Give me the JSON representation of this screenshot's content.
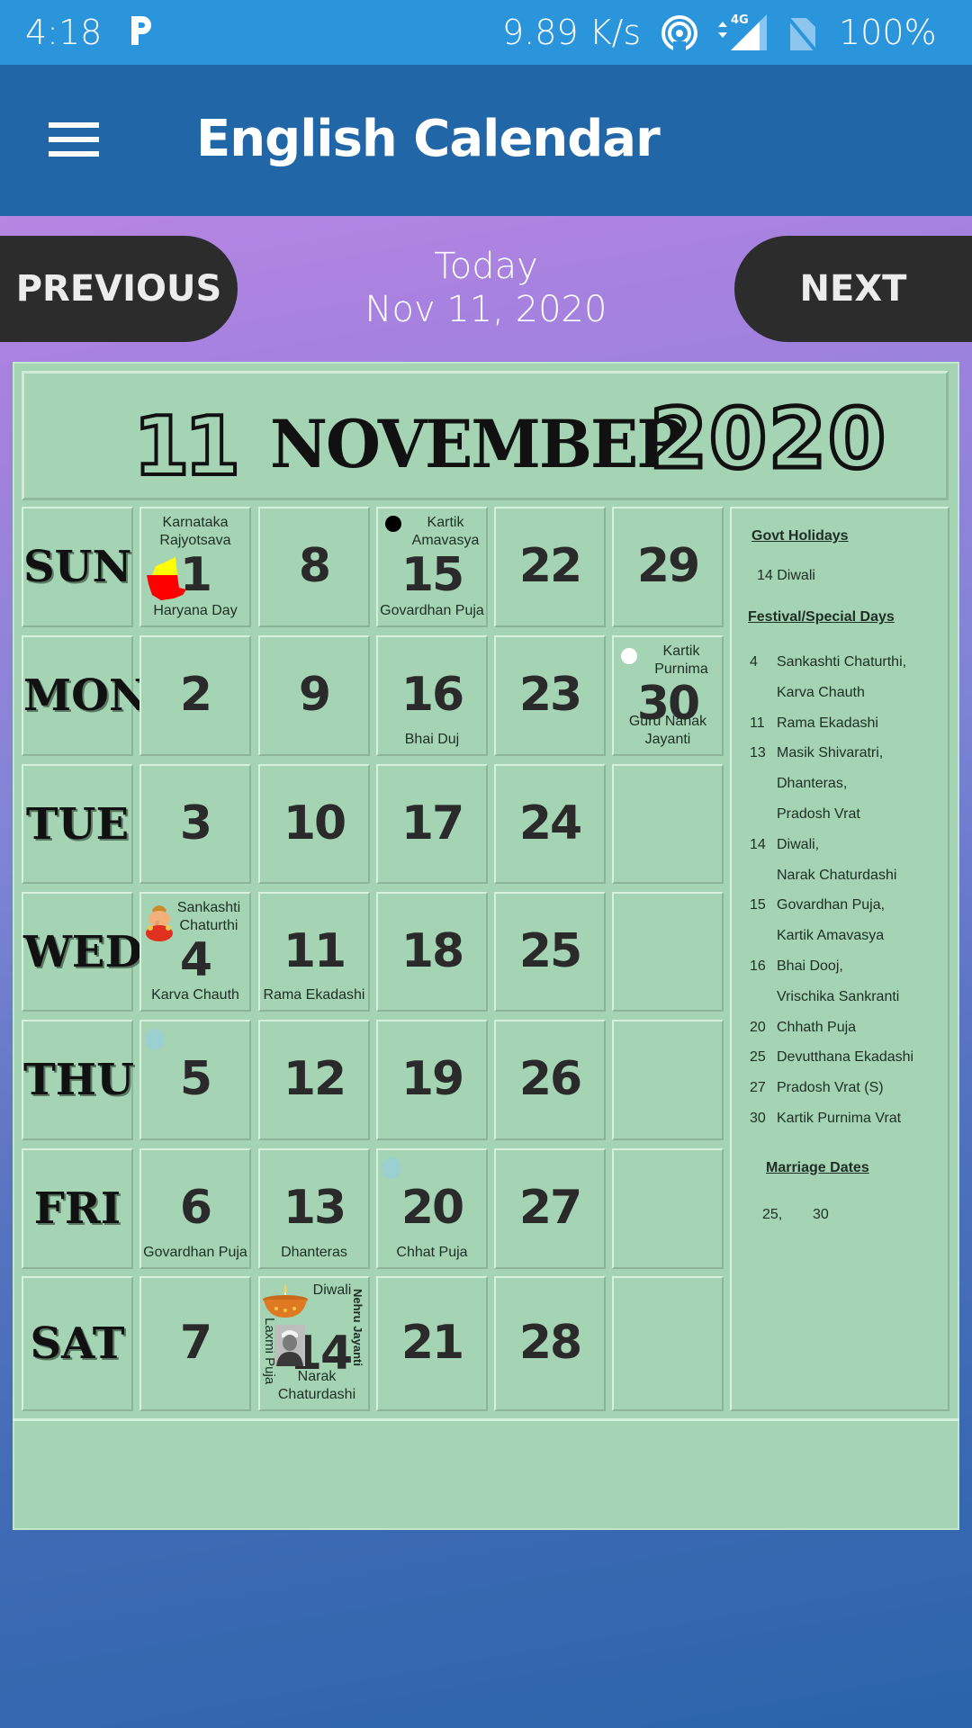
{
  "status_bar": {
    "time": "4:18",
    "network_speed": "9.89 K/s",
    "network_type": "4G",
    "battery": "100%",
    "icons": [
      "parking-app-icon",
      "hotspot-icon",
      "signal-4g-icon",
      "no-sim-icon"
    ]
  },
  "app_bar": {
    "title": "English Calendar",
    "menu_icon": "hamburger-menu-icon"
  },
  "navigation": {
    "previous_label": "PREVIOUS",
    "next_label": "NEXT",
    "today_label": "Today",
    "today_date": "Nov 11, 2020"
  },
  "calendar": {
    "title_day": "11",
    "title_month": "NOVEMBER",
    "title_year": "2020",
    "colors": {
      "panel": "#a4d4b4",
      "status_bar": "#2b95dc",
      "app_bar": "#2166a7",
      "button": "#2c2c2c"
    },
    "weekdays": [
      "SUN",
      "MON",
      "TUE",
      "WED",
      "THU",
      "FRI",
      "SAT"
    ],
    "weeks": [
      [
        {
          "day": "1",
          "top": "Karnataka Rajyotsava",
          "bottom": "Haryana Day",
          "icon": "karnataka-flag-map-icon"
        },
        {
          "day": "2"
        },
        {
          "day": "3"
        },
        {
          "day": "4",
          "top": "Sankashti Chaturthi",
          "bottom": "Karva Chauth",
          "icon": "ganesha-icon"
        },
        {
          "day": "5",
          "icon": "faint-moon-dot-icon"
        },
        {
          "day": "6",
          "bottom": "Govardhan Puja"
        },
        {
          "day": "7"
        }
      ],
      [
        {
          "day": "8"
        },
        {
          "day": "9"
        },
        {
          "day": "10"
        },
        {
          "day": "11",
          "bottom": "Rama Ekadashi"
        },
        {
          "day": "12"
        },
        {
          "day": "13",
          "bottom": "Dhanteras"
        },
        {
          "day": "14",
          "top": "Diwali",
          "bottom": "Narak Chaturdashi",
          "vertical_left": "Laxmi Puja",
          "vertical_right": "Nehru Jayanti",
          "icon": "diya-lamp-icon",
          "icon2": "nehru-portrait-icon"
        }
      ],
      [
        {
          "day": "15",
          "top": "Kartik Amavasya",
          "bottom": "Govardhan Puja",
          "icon": "new-moon-icon"
        },
        {
          "day": "16",
          "bottom": "Bhai Duj"
        },
        {
          "day": "17"
        },
        {
          "day": "18"
        },
        {
          "day": "19"
        },
        {
          "day": "20",
          "bottom": "Chhat Puja",
          "icon": "faint-moon-dot-icon"
        },
        {
          "day": "21"
        }
      ],
      [
        {
          "day": "22"
        },
        {
          "day": "23"
        },
        {
          "day": "24"
        },
        {
          "day": "25"
        },
        {
          "day": "26"
        },
        {
          "day": "27"
        },
        {
          "day": "28"
        }
      ],
      [
        {
          "day": "29"
        },
        {
          "day": "30",
          "top": "Kartik Purnima",
          "bottom": "Guru Nanak Jayanti",
          "icon": "full-moon-icon"
        },
        {
          "day": ""
        },
        {
          "day": ""
        },
        {
          "day": ""
        },
        {
          "day": ""
        },
        {
          "day": ""
        }
      ]
    ]
  },
  "side_panel": {
    "govt_holidays_heading": "Govt Holidays",
    "govt_holidays": [
      {
        "date": "14",
        "name": "Diwali"
      }
    ],
    "festivals_heading": "Festival/Special Days",
    "festivals": [
      {
        "date": "4",
        "lines": [
          "Sankashti Chaturthi,",
          "Karva Chauth"
        ]
      },
      {
        "date": "11",
        "lines": [
          "Rama Ekadashi"
        ]
      },
      {
        "date": "13",
        "lines": [
          "Masik Shivaratri,",
          "Dhanteras,",
          "Pradosh Vrat"
        ]
      },
      {
        "date": "14",
        "lines": [
          "Diwali,",
          "Narak Chaturdashi"
        ]
      },
      {
        "date": "15",
        "lines": [
          "Govardhan Puja,",
          "Kartik Amavasya"
        ]
      },
      {
        "date": "16",
        "lines": [
          "Bhai Dooj,",
          "Vrischika Sankranti"
        ]
      },
      {
        "date": "20",
        "lines": [
          "Chhath Puja"
        ]
      },
      {
        "date": "25",
        "lines": [
          "Devutthana Ekadashi"
        ]
      },
      {
        "date": "27",
        "lines": [
          "Pradosh Vrat (S)"
        ]
      },
      {
        "date": "30",
        "lines": [
          "Kartik Purnima Vrat"
        ]
      }
    ],
    "marriage_heading": "Marriage Dates",
    "marriage_dates": [
      "25,",
      "30"
    ]
  }
}
